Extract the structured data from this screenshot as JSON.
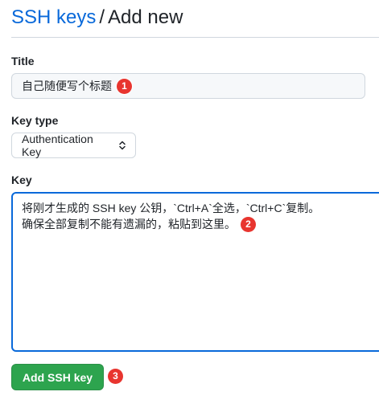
{
  "breadcrumb": {
    "parent": "SSH keys",
    "separator": "/",
    "current": "Add new"
  },
  "fields": {
    "title": {
      "label": "Title",
      "value": "自己随便写个标题",
      "marker": "1"
    },
    "key_type": {
      "label": "Key type",
      "selected": "Authentication Key"
    },
    "key": {
      "label": "Key",
      "line1": "将刚才生成的 SSH key 公钥，`Ctrl+A`全选，`Ctrl+C`复制。",
      "line2": "确保全部复制不能有遗漏的，粘贴到这里。",
      "marker": "2"
    }
  },
  "submit": {
    "label": "Add SSH key",
    "marker": "3"
  },
  "colors": {
    "link": "#0969da",
    "button_bg": "#2da44e",
    "marker": "#e8352f",
    "focus_border": "#0969da"
  },
  "icons": {
    "select_arrows": "select-arrows-icon"
  }
}
